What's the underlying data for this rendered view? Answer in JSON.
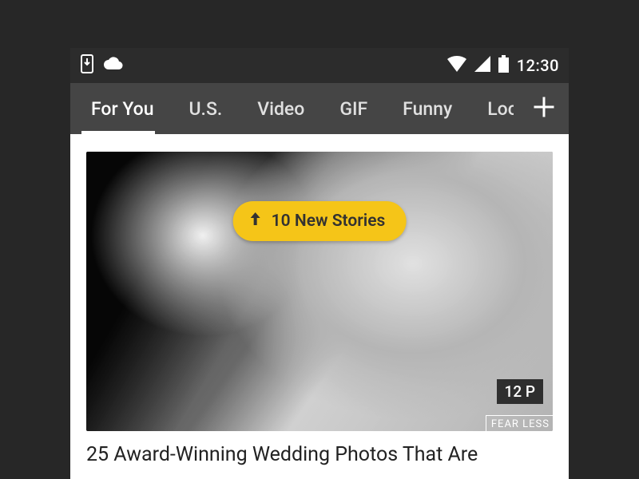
{
  "status": {
    "clock": "12:30"
  },
  "tabs": {
    "items": [
      "For You",
      "U.S.",
      "Video",
      "GIF",
      "Funny",
      "Loc"
    ],
    "active_index": 0
  },
  "new_stories_pill": {
    "label": "10 New Stories"
  },
  "hero": {
    "photo_count_label": "12 P",
    "watermark": "FEAR\nLESS"
  },
  "article": {
    "headline": "25 Award-Winning Wedding Photos That Are"
  },
  "colors": {
    "accent_yellow": "#F5C518",
    "tabbar_bg": "#454545",
    "statusbar_bg": "#2c2c2c",
    "page_bg": "#272727"
  }
}
